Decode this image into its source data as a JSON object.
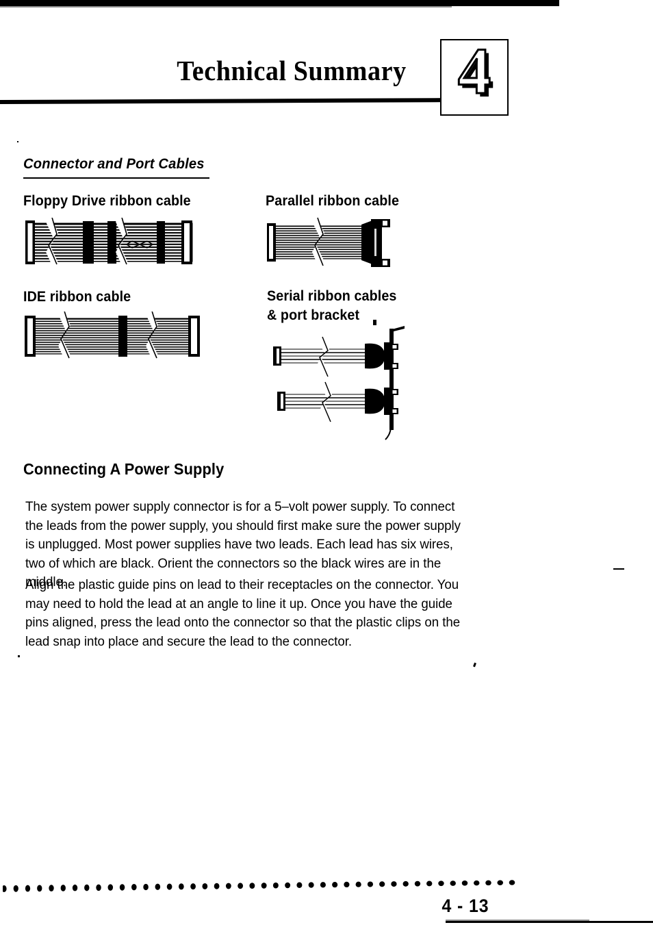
{
  "document": {
    "header": {
      "chapter_title": "Technical Summary",
      "chapter_number": "4"
    },
    "section": {
      "title": "Connector and Port Cables"
    },
    "figures": [
      {
        "id": "floppy-drive-ribbon-cable",
        "label": "Floppy Drive ribbon cable",
        "description": "Striped ribbon cable with end connectors, two inline connectors, break marks and a twisted-pair X marking",
        "connector_count": 5,
        "break_marks": 2,
        "twist_marker": "X"
      },
      {
        "id": "parallel-ribbon-cable",
        "label": "Parallel ribbon cable",
        "description": "Ribbon cable with header connector at left and D-sub port connector with mounting ears at right",
        "connector_count": 2,
        "break_marks": 1
      },
      {
        "id": "ide-ribbon-cable",
        "label": "IDE ribbon cable",
        "description": "Striped ribbon cable with two end connectors and one inline connector",
        "connector_count": 3,
        "break_marks": 2
      },
      {
        "id": "serial-ribbon-cables-and-port-bracket",
        "label": "Serial ribbon cables\n& port bracket",
        "description": "Two thin ribbon cables each terminating in a D-sub connector mounted on a vertical port bracket",
        "cable_count": 2,
        "break_marks": 2
      }
    ],
    "body": {
      "heading": "Connecting A Power Supply",
      "paragraphs": [
        "The system power supply connector is for a 5–volt power supply. To connect the leads from the power supply, you should first make sure the power supply is unplugged. Most power supplies have two leads. Each lead has six wires, two of which are black. Orient the connectors so the black wires are in the middle.",
        "Align the plastic guide pins on lead to their receptacles on the connector. You may need to hold the lead at an angle to line it up. Once you have the guide pins aligned, press the lead onto the connector so that the plastic clips on the lead snap into place and secure the lead to the connector."
      ]
    },
    "footer": {
      "page_number": "4 - 13",
      "dot_count": 44
    },
    "colors": {
      "ink": "#000000",
      "paper": "#ffffff"
    }
  }
}
